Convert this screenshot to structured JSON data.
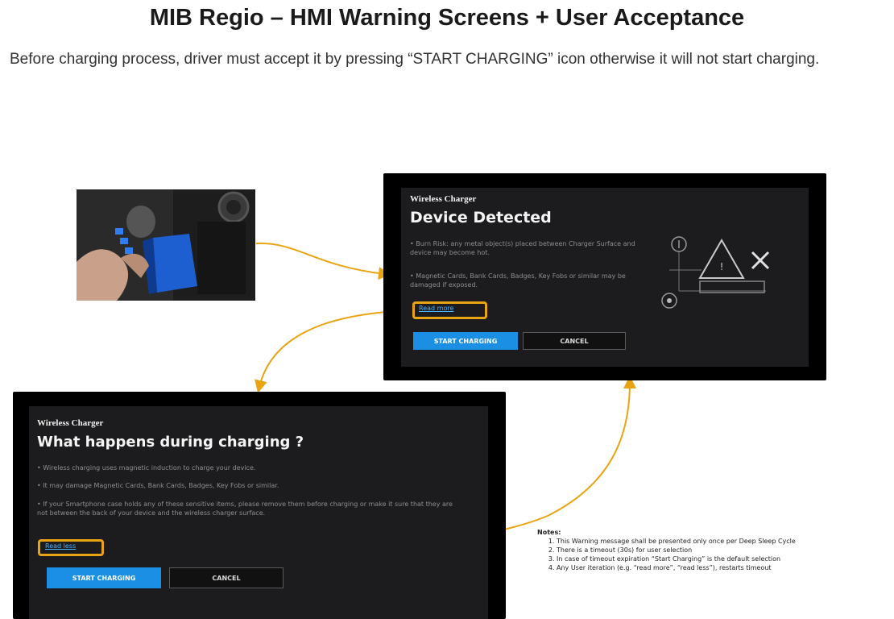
{
  "slide": {
    "title": "MIB Regio – HMI Warning Screens + User Acceptance",
    "subtitle": "Before charging process, driver must accept it by pressing “START CHARGING” icon otherwise it will not start charging."
  },
  "screen_detected": {
    "small_title": "Wireless Charger",
    "big_title": "Device Detected",
    "bullets": [
      "• Burn Risk: any metal object(s) placed between Charger Surface and device may become hot.",
      "• Magnetic Cards, Bank Cards, Badges, Key Fobs or similar may be damaged if exposed."
    ],
    "link": "Read more",
    "start_button": "START CHARGING",
    "cancel_button": "CANCEL"
  },
  "screen_info": {
    "small_title": "Wireless Charger",
    "big_title": "What happens during charging ?",
    "bullets": [
      "• Wireless charging uses magnetic induction to charge your device.",
      "• It may damage Magnetic Cards, Bank Cards, Badges, Key Fobs or similar.",
      "• If your Smartphone case holds any of these sensitive items, please remove them before charging or make it sure that they are not between the back of your device and the wireless charger surface."
    ],
    "link": "Read less",
    "start_button": "START CHARGING",
    "cancel_button": "CANCEL"
  },
  "notes": {
    "heading": "Notes:",
    "items": [
      "This Warning message shall be presented only once per Deep Sleep Cycle",
      "There is a timeout (30s) for user selection",
      "In case of timeout expiration “Start Charging” is the default selection",
      "Any User iteration (e.g. “read more”, “read less”), restarts timeout"
    ]
  },
  "colors": {
    "connector": "#e8a413",
    "button_primary": "#1a8fe3",
    "hmi_background": "#1c1c1e"
  }
}
